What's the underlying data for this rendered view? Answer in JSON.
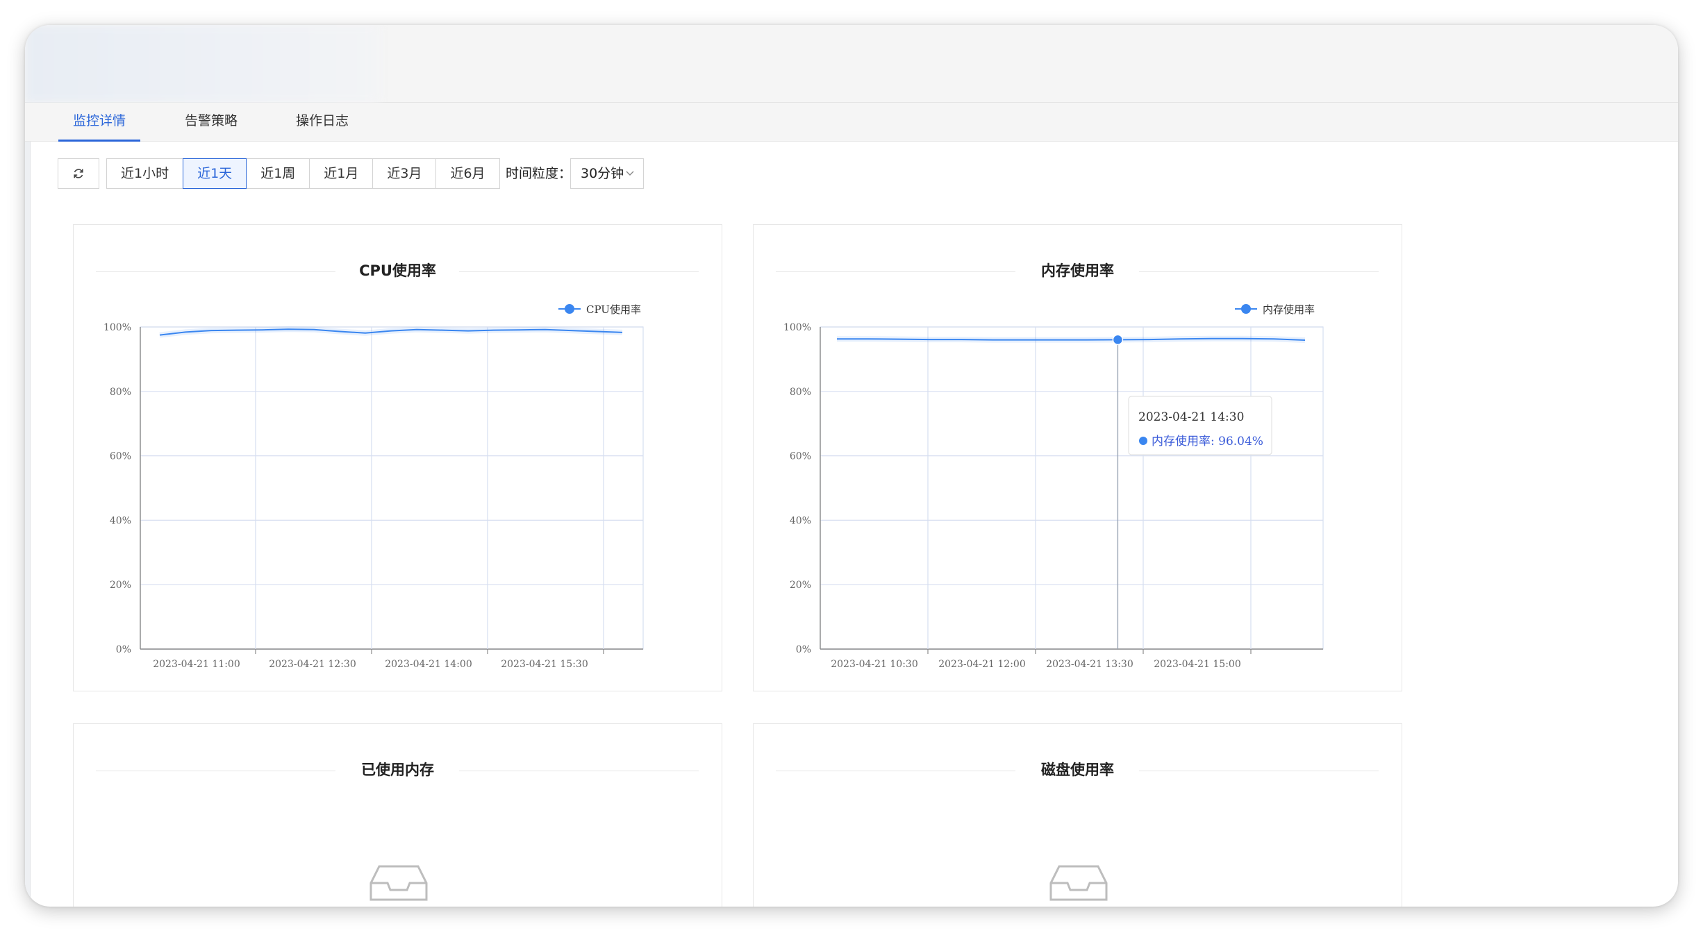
{
  "tabs": [
    {
      "label": "监控详情"
    },
    {
      "label": "告警策略"
    },
    {
      "label": "操作日志"
    }
  ],
  "toolbar": {
    "ranges": [
      "近1小时",
      "近1天",
      "近1周",
      "近1月",
      "近3月",
      "近6月"
    ],
    "active_range": "近1天",
    "granularity_label": "时间粒度：",
    "granularity_value": "30分钟"
  },
  "panels": [
    {
      "title": "CPU使用率"
    },
    {
      "title": "内存使用率"
    },
    {
      "title": "已使用内存"
    },
    {
      "title": "磁盘使用率"
    }
  ],
  "tooltip": {
    "time": "2023-04-21 14:30",
    "series": "内存使用率",
    "value": "96.04%"
  },
  "chart_data": [
    {
      "type": "line",
      "title": "CPU使用率",
      "legend": "CPU使用率",
      "ylim": [
        0,
        100
      ],
      "y_ticks": [
        "0%",
        "20%",
        "40%",
        "60%",
        "80%",
        "100%"
      ],
      "x_tick_labels": [
        "2023-04-21 11:00",
        "2023-04-21 12:30",
        "2023-04-21 14:00",
        "2023-04-21 15:30"
      ],
      "color": "#3a86f0",
      "series": [
        {
          "name": "CPU使用率",
          "values": [
            97.5,
            98.4,
            98.9,
            99.0,
            99.1,
            99.3,
            99.2,
            98.6,
            98.1,
            98.8,
            99.2,
            99.0,
            98.8,
            99.0,
            99.1,
            99.2,
            98.9,
            98.6,
            98.3
          ]
        }
      ]
    },
    {
      "type": "line",
      "title": "内存使用率",
      "legend": "内存使用率",
      "ylim": [
        0,
        100
      ],
      "y_ticks": [
        "0%",
        "20%",
        "40%",
        "60%",
        "80%",
        "100%"
      ],
      "x_tick_labels": [
        "2023-04-21 10:30",
        "2023-04-21 12:00",
        "2023-04-21 13:30",
        "2023-04-21 15:00"
      ],
      "color": "#3a86f0",
      "series": [
        {
          "name": "内存使用率",
          "values": [
            96.3,
            96.3,
            96.2,
            96.1,
            96.1,
            96.0,
            96.0,
            96.0,
            96.0,
            96.04,
            96.1,
            96.3,
            96.4,
            96.4,
            96.3,
            95.9
          ]
        }
      ]
    }
  ],
  "colors": {
    "accent": "#2b66d9",
    "line": "#3a86f0",
    "grid": "#d6def0"
  },
  "icons": {
    "refresh": "refresh-icon",
    "empty": "empty-inbox-icon",
    "chevron": "chevron-down-icon"
  }
}
